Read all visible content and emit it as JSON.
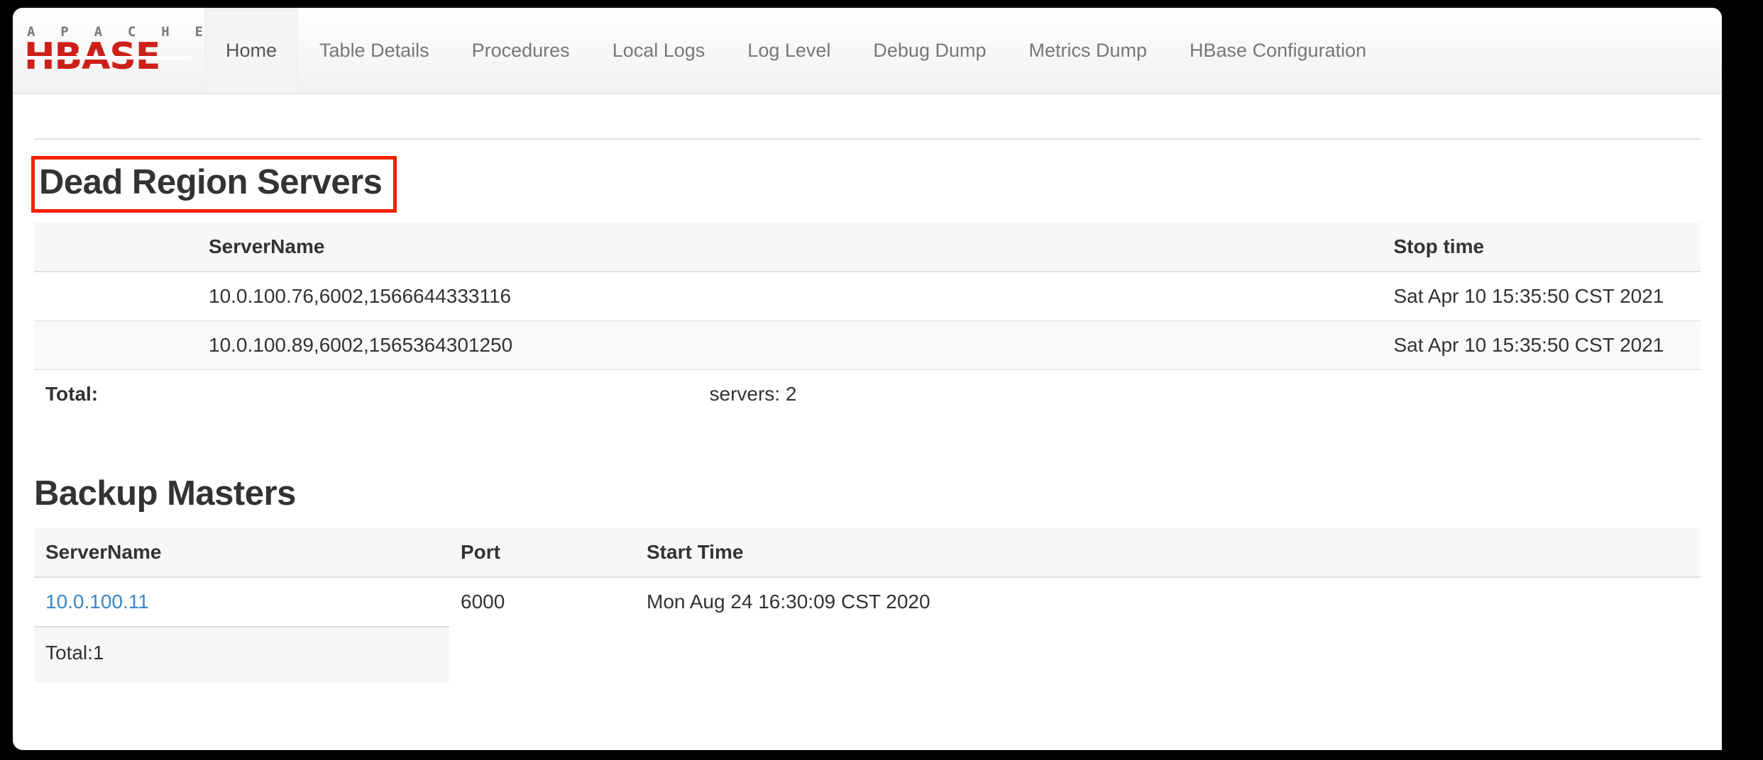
{
  "brand": {
    "apache_letters": [
      "A",
      "P",
      "A",
      "C",
      "H",
      "E"
    ],
    "wordmark": "HBASE",
    "color": "#cc2018"
  },
  "nav": {
    "items": [
      {
        "label": "Home",
        "active": true
      },
      {
        "label": "Table Details",
        "active": false
      },
      {
        "label": "Procedures",
        "active": false
      },
      {
        "label": "Local Logs",
        "active": false
      },
      {
        "label": "Log Level",
        "active": false
      },
      {
        "label": "Debug Dump",
        "active": false
      },
      {
        "label": "Metrics Dump",
        "active": false
      },
      {
        "label": "HBase Configuration",
        "active": false
      }
    ]
  },
  "annotation": {
    "color": "#f42000",
    "target": "Dead Region Servers"
  },
  "dead_region_servers": {
    "title": "Dead Region Servers",
    "columns": [
      "ServerName",
      "Stop time"
    ],
    "rows": [
      {
        "server_name": "10.0.100.76,6002,1566644333116",
        "stop_time": "Sat Apr 10 15:35:50 CST 2021"
      },
      {
        "server_name": "10.0.100.89,6002,1565364301250",
        "stop_time": "Sat Apr 10 15:35:50 CST 2021"
      }
    ],
    "total_label": "Total:",
    "total_value": "servers: 2"
  },
  "backup_masters": {
    "title": "Backup Masters",
    "columns": [
      "ServerName",
      "Port",
      "Start Time"
    ],
    "rows": [
      {
        "server_name": "10.0.100.11",
        "port": "6000",
        "start_time": "Mon Aug 24 16:30:09 CST 2020"
      }
    ],
    "total_label": "Total:1"
  }
}
